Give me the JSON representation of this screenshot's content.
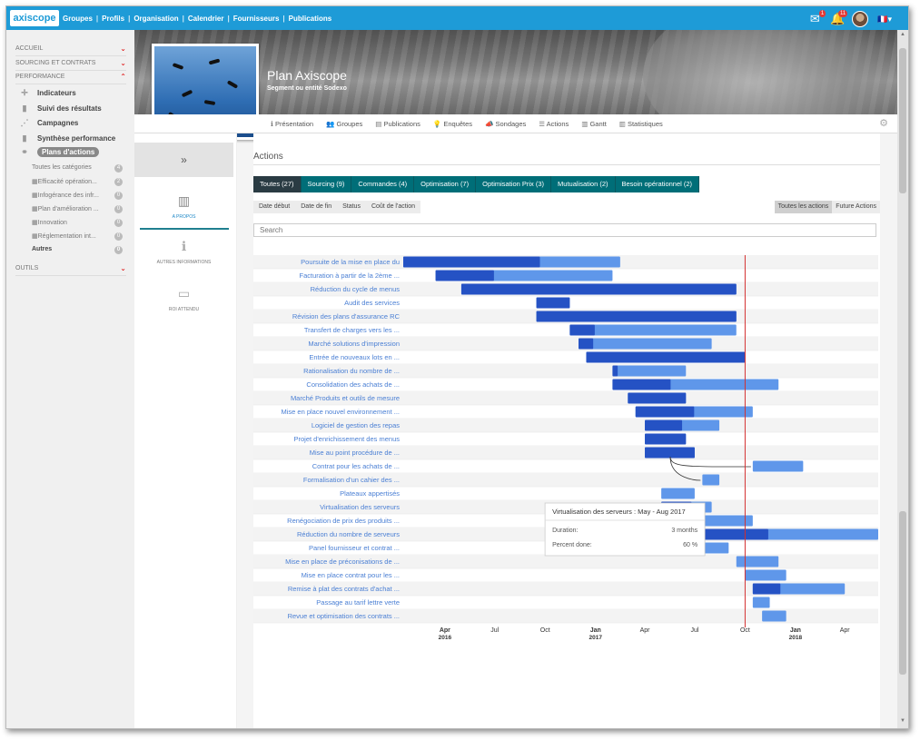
{
  "app": {
    "logo": "axiscope"
  },
  "topnav": [
    "Groupes",
    "Profils",
    "Organisation",
    "Calendrier",
    "Fournisseurs",
    "Publications"
  ],
  "top_icons": {
    "mail_badge": "1",
    "bell_badge": "11"
  },
  "sidebar": {
    "sections": [
      {
        "label": "ACCUEIL"
      },
      {
        "label": "SOURCING ET CONTRATS"
      },
      {
        "label": "PERFORMANCE"
      }
    ],
    "items": [
      {
        "label": "Indicateurs",
        "icon": "plus-icon"
      },
      {
        "label": "Suivi des résultats",
        "icon": "bar-chart-icon"
      },
      {
        "label": "Campagnes",
        "icon": "nodes-icon"
      },
      {
        "label": "Synthèse performance",
        "icon": "bar-chart-icon"
      },
      {
        "label": "Plans d'actions",
        "icon": "handshake-icon"
      }
    ],
    "subitems": [
      {
        "label": "Toutes les catégories",
        "count": "4"
      },
      {
        "label": "Efficacité opération...",
        "count": "2"
      },
      {
        "label": "Infogérance des infr...",
        "count": "0"
      },
      {
        "label": "Plan d'amélioration ...",
        "count": "0"
      },
      {
        "label": "Innovation",
        "count": "0"
      },
      {
        "label": "Réglementation int...",
        "count": "0"
      },
      {
        "label": "Autres",
        "count": "0"
      }
    ],
    "tools": "OUTILS"
  },
  "header": {
    "title": "Plan Axiscope",
    "subtitle": "Segment ou entité Sodexo",
    "tabs": [
      "Présentation",
      "Groupes",
      "Publications",
      "Enquêtes",
      "Sondages",
      "Actions",
      "Gantt",
      "Statistiques"
    ]
  },
  "leftcol": {
    "items": [
      "A PROPOS",
      "AUTRES INFORMATIONS",
      "ROI ATTENDU"
    ]
  },
  "main": {
    "title": "Actions",
    "filter_tabs": [
      "Toutes (27)",
      "Sourcing (9)",
      "Commandes (4)",
      "Optimisation (7)",
      "Optimisation Prix (3)",
      "Mutualisation (2)",
      "Besoin opérationnel (2)"
    ],
    "sort_buttons": [
      "Date début",
      "Date de fin",
      "Status",
      "Coût de l'action"
    ],
    "right_buttons": [
      "Toutes les actions",
      "Future Actions"
    ],
    "search_placeholder": "Search"
  },
  "colors": {
    "dark_bar": "#2552c4",
    "light_bar": "#5f97ea",
    "tab_teal": "#006e78",
    "today": "#d32f2f"
  },
  "chart_data": {
    "type": "gantt",
    "time_unit": "month",
    "x_ticks": [
      {
        "label": "Apr",
        "sub": "2016",
        "t": "2016-04"
      },
      {
        "label": "Jul",
        "sub": "",
        "t": "2016-07"
      },
      {
        "label": "Oct",
        "sub": "",
        "t": "2016-10"
      },
      {
        "label": "Jan",
        "sub": "2017",
        "t": "2017-01"
      },
      {
        "label": "Apr",
        "sub": "",
        "t": "2017-04"
      },
      {
        "label": "Jul",
        "sub": "",
        "t": "2017-07"
      },
      {
        "label": "Oct",
        "sub": "",
        "t": "2017-10"
      },
      {
        "label": "Jan",
        "sub": "2018",
        "t": "2018-01"
      },
      {
        "label": "Apr",
        "sub": "",
        "t": "2018-04"
      }
    ],
    "xlim": [
      "2016-01-16",
      "2018-06-01"
    ],
    "today": "2017-10-01",
    "tasks": [
      {
        "name": "Poursuite de la mise en place du",
        "start": "2016-01-16",
        "end": "2017-02-15",
        "done": 0.63
      },
      {
        "name": "Facturation à partir de la 2ème ...",
        "start": "2016-03-15",
        "end": "2017-02-01",
        "done": 0.33
      },
      {
        "name": "Réduction du cycle de menus",
        "start": "2016-05-01",
        "end": "2017-09-15",
        "done": 1.0
      },
      {
        "name": "Audit des services",
        "start": "2016-09-15",
        "end": "2016-11-15",
        "done": 1.0
      },
      {
        "name": "Révision des plans d'assurance RC",
        "start": "2016-09-15",
        "end": "2017-09-15",
        "done": 1.0
      },
      {
        "name": "Transfert de charges vers les ...",
        "start": "2016-11-15",
        "end": "2017-09-15",
        "done": 0.15
      },
      {
        "name": "Marché solutions d'impression",
        "start": "2016-12-01",
        "end": "2017-08-01",
        "done": 0.11
      },
      {
        "name": "Entrée de nouveaux lots en ...",
        "start": "2016-12-15",
        "end": "2017-10-01",
        "done": 1.0
      },
      {
        "name": "Rationalisation du nombre de ...",
        "start": "2017-02-01",
        "end": "2017-06-15",
        "done": 0.07
      },
      {
        "name": "Consolidation des achats de ...",
        "start": "2017-02-01",
        "end": "2017-12-01",
        "done": 0.35
      },
      {
        "name": "Marché Produits et outils de mesure",
        "start": "2017-03-01",
        "end": "2017-06-15",
        "done": 1.0
      },
      {
        "name": "Mise en place nouvel environnement ...",
        "start": "2017-03-15",
        "end": "2017-10-15",
        "done": 0.5
      },
      {
        "name": "Logiciel de gestion des repas",
        "start": "2017-04-01",
        "end": "2017-08-15",
        "done": 0.5
      },
      {
        "name": "Projet d'enrichissement des menus",
        "start": "2017-04-01",
        "end": "2017-06-15",
        "done": 1.0
      },
      {
        "name": "Mise au point procédure de ...",
        "start": "2017-04-01",
        "end": "2017-07-01",
        "done": 1.0
      },
      {
        "name": "Contrat pour les achats de ...",
        "start": "2017-10-15",
        "end": "2018-01-15",
        "done": 0.0
      },
      {
        "name": "Formalisation d'un cahier des ...",
        "start": "2017-07-15",
        "end": "2017-08-15",
        "done": 0.0
      },
      {
        "name": "Plateaux appertisés",
        "start": "2017-05-01",
        "end": "2017-07-01",
        "done": 0.0
      },
      {
        "name": "Virtualisation des serveurs",
        "start": "2017-05-01",
        "end": "2017-08-01",
        "done": 0.6
      },
      {
        "name": "Renégociation de prix des produits ...",
        "start": "2017-06-01",
        "end": "2017-10-15",
        "done": 0.0
      },
      {
        "name": "Réduction du nombre de serveurs",
        "start": "2017-06-01",
        "end": "2018-06-01",
        "done": 0.45
      },
      {
        "name": "Panel fournisseur et contrat ...",
        "start": "2017-07-01",
        "end": "2017-09-01",
        "done": 0.0
      },
      {
        "name": "Mise en place de préconisations de ...",
        "start": "2017-09-15",
        "end": "2017-12-01",
        "done": 0.0
      },
      {
        "name": "Mise en place contrat pour les ...",
        "start": "2017-10-01",
        "end": "2017-12-15",
        "done": 0.0
      },
      {
        "name": "Remise à plat des contrats d'achat ...",
        "start": "2017-10-15",
        "end": "2018-04-01",
        "done": 0.3
      },
      {
        "name": "Passage au tarif lettre verte",
        "start": "2017-10-15",
        "end": "2017-11-15",
        "done": 0.0
      },
      {
        "name": "Revue et optimisation des contrats ...",
        "start": "2017-11-01",
        "end": "2017-12-15",
        "done": 0.0
      }
    ],
    "tooltip": {
      "title": "Virtualisation des serveurs : May - Aug 2017",
      "duration_label": "Duration:",
      "duration_value": "3 months",
      "done_label": "Percent done:",
      "done_value": "60 %"
    }
  }
}
